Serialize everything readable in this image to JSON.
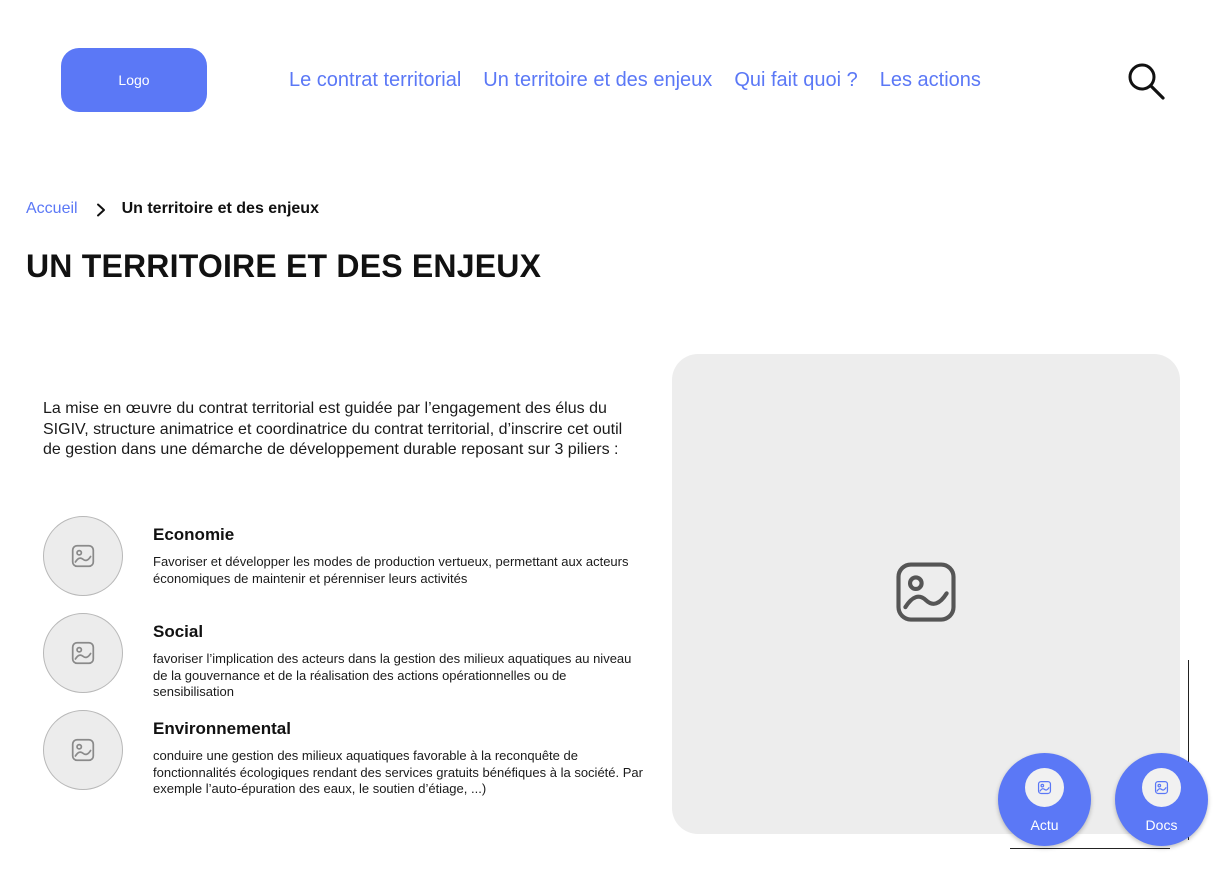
{
  "header": {
    "logo_label": "Logo",
    "nav": [
      {
        "label": "Le contrat territorial"
      },
      {
        "label": "Un territoire et des enjeux"
      },
      {
        "label": "Qui fait quoi ?"
      },
      {
        "label": "Les actions"
      }
    ],
    "search_icon": "search-icon"
  },
  "breadcrumb": {
    "home": "Accueil",
    "separator_icon": "chevron-right-icon",
    "current": "Un territoire et des enjeux"
  },
  "page_title": "UN TERRITOIRE ET DES ENJEUX",
  "intro": "La mise en œuvre du contrat territorial est guidée par l’engagement des élus du SIGIV, structure animatrice et coordinatrice du contrat territorial, d’inscrire cet outil de gestion dans une démarche de développement durable reposant sur 3 piliers :",
  "pillars": [
    {
      "title": "Economie",
      "description": "Favoriser et développer les modes de production vertueux, permettant aux acteurs économiques de maintenir et pérenniser leurs activités",
      "icon": "image-placeholder-icon"
    },
    {
      "title": "Social",
      "description": "favoriser l’implication des acteurs dans la gestion des milieux aquatiques au niveau de la gouvernance et de la réalisation des actions opérationnelles ou de sensibilisation",
      "icon": "image-placeholder-icon"
    },
    {
      "title": "Environnemental",
      "description": "conduire une gestion des milieux aquatiques favorable à la reconquête de fonctionnalités écologiques rendant des services gratuits bénéfiques à la société. Par exemple l’auto-épuration des eaux, le soutien d’étiage, ...)",
      "icon": "image-placeholder-icon"
    }
  ],
  "hero_image": {
    "icon": "image-placeholder-icon"
  },
  "floating_buttons": [
    {
      "label": "Actu",
      "icon": "image-placeholder-icon"
    },
    {
      "label": "Docs",
      "icon": "image-placeholder-icon"
    }
  ],
  "colors": {
    "accent": "#5b78f6",
    "placeholder_bg": "#ededed",
    "text": "#111111"
  }
}
